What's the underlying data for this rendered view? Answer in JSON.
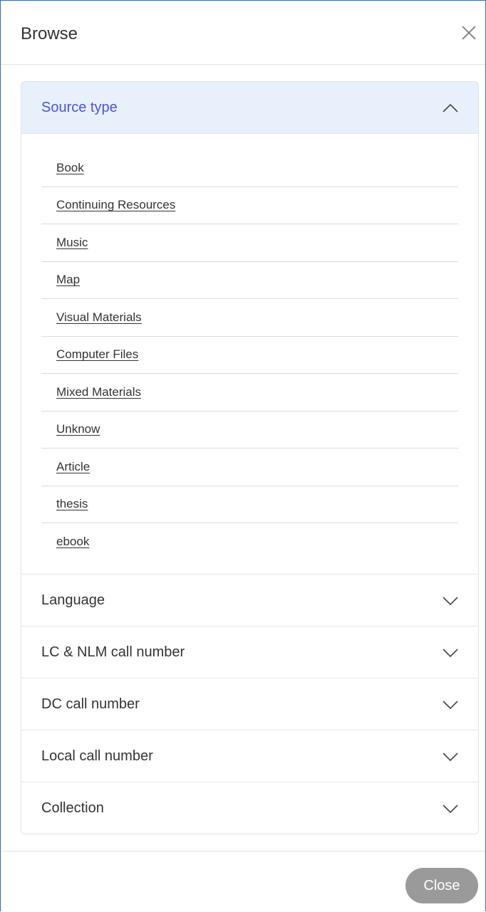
{
  "modal": {
    "title": "Browse",
    "close_icon": "close-icon",
    "footer_button": "Close"
  },
  "accordion": {
    "active": {
      "title": "Source type",
      "icon": "chevron-up-icon",
      "items": [
        "Book",
        "Continuing Resources",
        "Music",
        "Map",
        "Visual Materials",
        "Computer Files",
        "Mixed Materials",
        "Unknow",
        "Article",
        "thesis",
        "ebook"
      ]
    },
    "collapsed": [
      {
        "title": "Language",
        "icon": "chevron-down-icon"
      },
      {
        "title": "LC & NLM call number",
        "icon": "chevron-down-icon"
      },
      {
        "title": "DC call number",
        "icon": "chevron-down-icon"
      },
      {
        "title": "Local call number",
        "icon": "chevron-down-icon"
      },
      {
        "title": "Collection",
        "icon": "chevron-down-icon"
      }
    ]
  },
  "colors": {
    "active_header_bg": "#e8f0fc",
    "active_header_text": "#4a55d6",
    "close_button_bg": "#9a9a9a",
    "modal_border": "#2f6db3"
  }
}
